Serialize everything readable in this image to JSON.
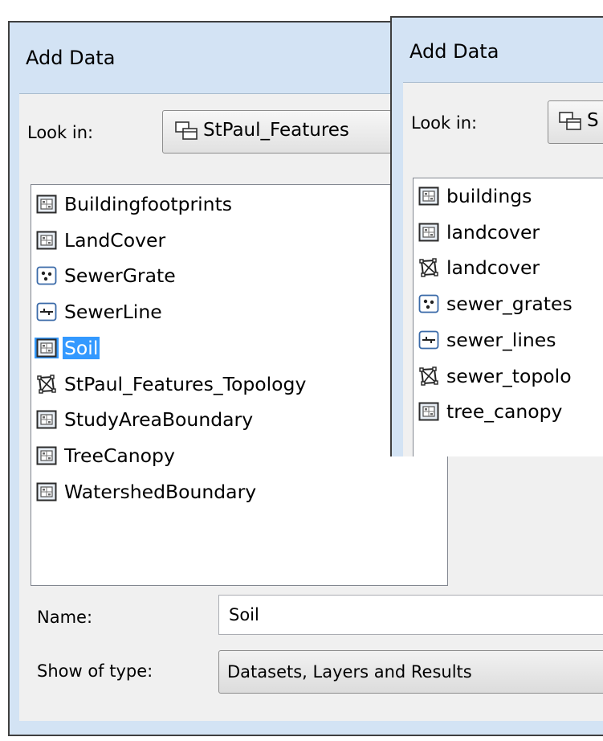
{
  "dialog_left": {
    "title": "Add Data",
    "look_in_label": "Look in:",
    "look_in_value": "StPaul_Features",
    "items": [
      {
        "label": "Buildingfootprints",
        "icon": "raster-dataset-icon"
      },
      {
        "label": "LandCover",
        "icon": "raster-dataset-icon"
      },
      {
        "label": "SewerGrate",
        "icon": "point-feature-class-icon"
      },
      {
        "label": "SewerLine",
        "icon": "line-feature-class-icon"
      },
      {
        "label": "Soil",
        "icon": "raster-dataset-icon",
        "selected": true
      },
      {
        "label": "StPaul_Features_Topology",
        "icon": "topology-icon"
      },
      {
        "label": "StudyAreaBoundary",
        "icon": "raster-dataset-icon"
      },
      {
        "label": "TreeCanopy",
        "icon": "raster-dataset-icon"
      },
      {
        "label": "WatershedBoundary",
        "icon": "raster-dataset-icon"
      }
    ],
    "name_label": "Name:",
    "name_value": "Soil",
    "show_type_label": "Show of type:",
    "show_type_value": "Datasets, Layers and Results"
  },
  "dialog_right": {
    "title": "Add Data",
    "look_in_label": "Look in:",
    "look_in_value": "S",
    "items": [
      {
        "label": "buildings",
        "icon": "raster-dataset-icon"
      },
      {
        "label": "landcover",
        "icon": "raster-dataset-icon"
      },
      {
        "label": "landcover",
        "icon": "topology-icon"
      },
      {
        "label": "sewer_grates",
        "icon": "point-feature-class-icon"
      },
      {
        "label": "sewer_lines",
        "icon": "line-feature-class-icon"
      },
      {
        "label": "sewer_topolo",
        "icon": "topology-icon"
      },
      {
        "label": "tree_canopy",
        "icon": "raster-dataset-icon"
      }
    ]
  }
}
